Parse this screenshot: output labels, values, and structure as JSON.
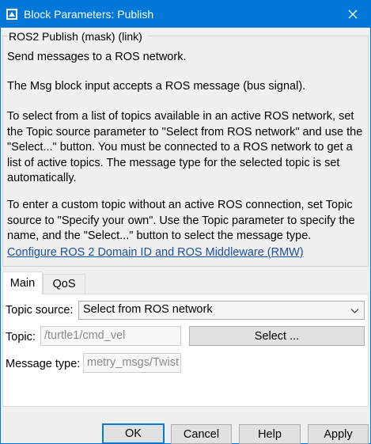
{
  "window": {
    "title": "Block Parameters: Publish",
    "icon": "simulink-block-icon",
    "close_icon": "close-icon"
  },
  "group": {
    "title": "ROS2 Publish (mask) (link)",
    "paragraphs": [
      "Send messages to a ROS network.",
      "The Msg block input accepts a ROS message (bus signal).",
      "To select from a list of topics available in an active ROS network, set the Topic source parameter to \"Select from ROS network\" and use the \"Select...\" button. You must be connected to a ROS network to get a list of active topics. The message type for the selected topic is set automatically.",
      "To enter a custom topic without an active ROS connection, set Topic source to \"Specify your own\". Use the Topic parameter to specify the name, and the \"Select...\" button to select the message type."
    ],
    "link": "Configure ROS 2 Domain ID and ROS Middleware (RMW)"
  },
  "tabs": [
    {
      "label": "Main",
      "active": true
    },
    {
      "label": "QoS",
      "active": false
    }
  ],
  "main": {
    "topic_source_label": "Topic source:",
    "topic_source_value": "Select from ROS network",
    "topic_label": "Topic:",
    "topic_value": "/turtle1/cmd_vel",
    "select_button": "Select ...",
    "message_type_label": "Message type:",
    "message_type_value": "metry_msgs/Twist"
  },
  "buttons": {
    "ok": "OK",
    "cancel": "Cancel",
    "help": "Help",
    "apply": "Apply"
  },
  "colors": {
    "titlebar": "#0078d7",
    "link": "#1a4fa3",
    "default_button_border": "#0078d7"
  }
}
